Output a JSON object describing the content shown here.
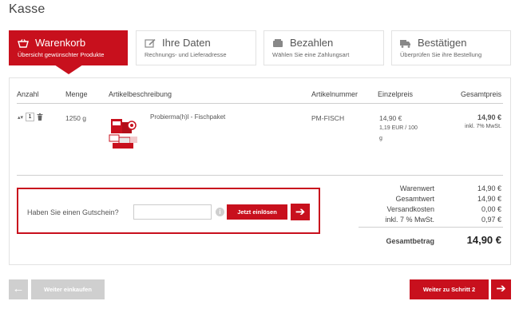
{
  "page": {
    "title": "Kasse"
  },
  "steps": [
    {
      "title": "Warenkorb",
      "subtitle": "Übersicht gewünschter Produkte",
      "icon": "basket-icon",
      "active": true
    },
    {
      "title": "Ihre Daten",
      "subtitle": "Rechnungs- und Lieferadresse",
      "icon": "edit-icon"
    },
    {
      "title": "Bezahlen",
      "subtitle": "Wählen Sie eine Zahlungsart",
      "icon": "wallet-icon"
    },
    {
      "title": "Bestätigen",
      "subtitle": "Überprüfen Sie ihre Bestellung",
      "icon": "truck-icon"
    }
  ],
  "table": {
    "headers": {
      "anzahl": "Anzahl",
      "menge": "Menge",
      "beschreibung": "Artikelbeschreibung",
      "nummer": "Artikelnummer",
      "einzelpreis": "Einzelpreis",
      "gesamtpreis": "Gesamtpreis"
    },
    "row": {
      "quantity": "1",
      "menge": "1250 g",
      "name": "Probierma(h)l - Fischpaket",
      "nummer": "PM-FISCH",
      "einzelpreis": "14,90 €",
      "grundpreis_line1": "1,19 EUR / 100",
      "grundpreis_line2": "g",
      "gesamtpreis": "14,90 €",
      "tax_note": "inkl. 7% MwSt."
    }
  },
  "voucher": {
    "label": "Haben Sie einen Gutschein?",
    "input_value": "",
    "info_glyph": "i",
    "button_label": "Jetzt einlösen",
    "arrow_glyph": "➔"
  },
  "totals": {
    "warenwert_label": "Warenwert",
    "warenwert": "14,90 €",
    "gesamtwert_label": "Gesamtwert",
    "gesamtwert": "14,90 €",
    "versand_label": "Versandkosten",
    "versand": "0,00 €",
    "mwst_label": "inkl. 7 % MwSt.",
    "mwst": "0,97 €",
    "gesamtbetrag_label": "Gesamtbetrag",
    "gesamtbetrag": "14,90 €"
  },
  "footer": {
    "back_label": "Weiter einkaufen",
    "back_glyph": "←",
    "next_label": "Weiter zu Schritt 2",
    "next_glyph": "➔"
  },
  "colors": {
    "accent": "#c8101d",
    "disabled": "#cfcfcf",
    "border": "#e2e2e2"
  }
}
